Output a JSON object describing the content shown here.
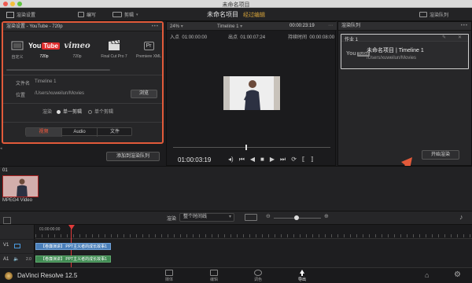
{
  "window": {
    "title": "未命名项目"
  },
  "toolbar": {
    "render_settings": "渲染设置",
    "edit_index": "编写",
    "clips": "剪辑",
    "project_title": "未命名项目",
    "project_status": "经过编辑",
    "render_queue": "渲染队列"
  },
  "render_settings": {
    "header": "渲染设置 - YouTube - 720p",
    "presets": [
      {
        "label": "自定义"
      },
      {
        "label": "720p",
        "you": "You",
        "tube": "Tube"
      },
      {
        "label": "720p",
        "logo": "vimeo"
      },
      {
        "label": "Final Cut Pro 7"
      },
      {
        "label": "Premiere XML",
        "logo": "Pr"
      }
    ],
    "filename_label": "文件名",
    "filename_value": "Timeline 1",
    "location_label": "位置",
    "location_value": "/Users/xuweilun/Movies",
    "browse_label": "浏览",
    "render_label": "渲染",
    "single_clip": "单一剪辑",
    "individual_clips": "单个剪辑",
    "tabs": [
      "视频",
      "Audio",
      "文件"
    ],
    "add_to_queue": "添加到渲染队列"
  },
  "viewer": {
    "zoom": "24%",
    "timeline_name": "Timeline 1",
    "timecode_top": "00:00:23:19",
    "in_label": "入点",
    "in_value": "01:00:00:00",
    "out_label": "出点",
    "out_value": "01:00:07:24",
    "duration_label": "持续时间",
    "duration_value": "00:00:08:00",
    "timecode": "01:00:03:19"
  },
  "render_queue": {
    "header": "渲染队列",
    "job_label": "作业 1",
    "job_title": "未命名项目 | Timeline 1",
    "job_path": "/Users/xuweilun/Movies",
    "start_render": "开始渲染"
  },
  "media": {
    "clip_index": "01",
    "clip_name": "MPEG4 Video"
  },
  "timeline": {
    "render_label": "渲染",
    "range_value": "整个时间线",
    "ruler_time": "01:00:00:00",
    "v1": "V1",
    "a1": "A1",
    "a1_level": "2.0",
    "clip_v1": "【卷廉演讲】 PPT主义者的成长故事1",
    "clip_a1": "【卷廉演讲】 PPT主义者的成长故事1"
  },
  "app": {
    "name": "DaVinci Resolve 12.5",
    "pages": [
      "媒体",
      "编辑",
      "调色",
      "导出"
    ],
    "active_page": "导出"
  },
  "colors": {
    "accent_red": "#e25a3a",
    "brand_orange": "#d9a53a"
  }
}
